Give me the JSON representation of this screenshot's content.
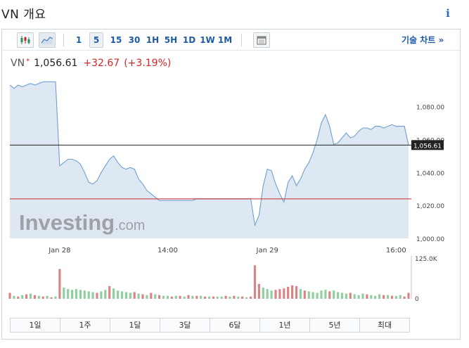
{
  "page": {
    "title": "VN 개요",
    "info_icon": "info-icon"
  },
  "toolbar": {
    "chart_type_candles_icon": "candlestick-icon",
    "chart_type_area_icon": "area-chart-icon",
    "timeframes": [
      "1",
      "5",
      "15",
      "30",
      "1H",
      "5H",
      "1D",
      "1W",
      "1M"
    ],
    "active_timeframe": "5",
    "calendar_icon": "calendar-icon",
    "technical_link": "기술 차트 »"
  },
  "quote": {
    "symbol": "VN",
    "marker": "*",
    "last": "1,056.61",
    "change": "+32.67",
    "change_pct": "(+3.19%)"
  },
  "colors": {
    "line": "#6f9fcf",
    "area": "#dde8f3",
    "up_volume": "#8fcfa0",
    "down_volume": "#d98585",
    "current_line": "#222222",
    "prev_close_line": "#c62828",
    "link": "#1e5aa8",
    "negative": "#d7242a"
  },
  "watermark": {
    "brand": "Investing",
    "suffix": ".com"
  },
  "chart_data": {
    "type": "area",
    "x_ticks": [
      "Jan 28",
      "14:00",
      "Jan 29",
      "16:00"
    ],
    "y_ticks": [
      "1,000.00",
      "1,020.00",
      "1,040.00",
      "1,060.00",
      "1,080.00"
    ],
    "ylim": [
      1000,
      1096
    ],
    "current_value": 1056.61,
    "current_label": "1,056.61",
    "previous_close": 1023.94,
    "grid": false,
    "price": [
      1093,
      1091,
      1093,
      1092,
      1093,
      1094,
      1093,
      1094,
      1095,
      1095,
      1095,
      1095,
      1044,
      1046,
      1048,
      1048,
      1047,
      1045,
      1040,
      1034,
      1033,
      1035,
      1040,
      1044,
      1048,
      1050,
      1046,
      1043,
      1042,
      1043,
      1042,
      1036,
      1033,
      1029,
      1027,
      1025,
      1023,
      1023,
      1023,
      1023,
      1023,
      1023,
      1023,
      1023,
      1023,
      1024,
      1024,
      1024,
      1024,
      1024,
      1024,
      1024,
      1024,
      1024,
      1024,
      1024,
      1024,
      1024,
      1024,
      1008,
      1014,
      1032,
      1042,
      1041,
      1033,
      1027,
      1022,
      1034,
      1038,
      1032,
      1036,
      1042,
      1046,
      1052,
      1060,
      1070,
      1075,
      1068,
      1057,
      1058,
      1061,
      1064,
      1061,
      1062,
      1065,
      1067,
      1067,
      1066,
      1068,
      1068,
      1067,
      1068,
      1069,
      1068,
      1068,
      1068,
      1056.61
    ],
    "volume_max_label": "125.0K",
    "volume_zero_label": "0",
    "volume": [
      8,
      4,
      3,
      5,
      6,
      7,
      5,
      4,
      3,
      4,
      2,
      3,
      40,
      15,
      13,
      12,
      13,
      12,
      11,
      10,
      9,
      8,
      10,
      12,
      17,
      14,
      11,
      10,
      9,
      8,
      9,
      7,
      6,
      5,
      8,
      6,
      5,
      4,
      4,
      3,
      4,
      4,
      3,
      5,
      4,
      4,
      4,
      3,
      3,
      3,
      3,
      3,
      4,
      3,
      4,
      3,
      3,
      2,
      3,
      45,
      20,
      15,
      13,
      11,
      12,
      13,
      14,
      16,
      18,
      17,
      13,
      11,
      10,
      9,
      8,
      11,
      12,
      10,
      11,
      9,
      8,
      7,
      8,
      6,
      5,
      7,
      6,
      5,
      4,
      6,
      5,
      5,
      4,
      4,
      5,
      3,
      8
    ],
    "volume_dir": [
      0,
      1,
      0,
      1,
      0,
      1,
      0,
      1,
      0,
      1,
      0,
      1,
      0,
      1,
      1,
      1,
      1,
      1,
      1,
      1,
      1,
      0,
      1,
      1,
      0,
      1,
      1,
      1,
      1,
      1,
      0,
      1,
      0,
      1,
      0,
      1,
      0,
      1,
      1,
      0,
      1,
      0,
      1,
      0,
      1,
      0,
      1,
      0,
      1,
      0,
      1,
      1,
      0,
      1,
      0,
      1,
      0,
      1,
      0,
      0,
      0,
      1,
      1,
      1,
      0,
      0,
      0,
      0,
      0,
      0,
      1,
      0,
      1,
      1,
      1,
      1,
      1,
      0,
      1,
      1,
      1,
      1,
      0,
      1,
      1,
      1,
      0,
      1,
      1,
      1,
      0,
      1,
      0,
      1,
      1,
      0,
      0
    ]
  },
  "ranges": [
    "1일",
    "1주",
    "1달",
    "3달",
    "6달",
    "1년",
    "5년",
    "최대"
  ]
}
